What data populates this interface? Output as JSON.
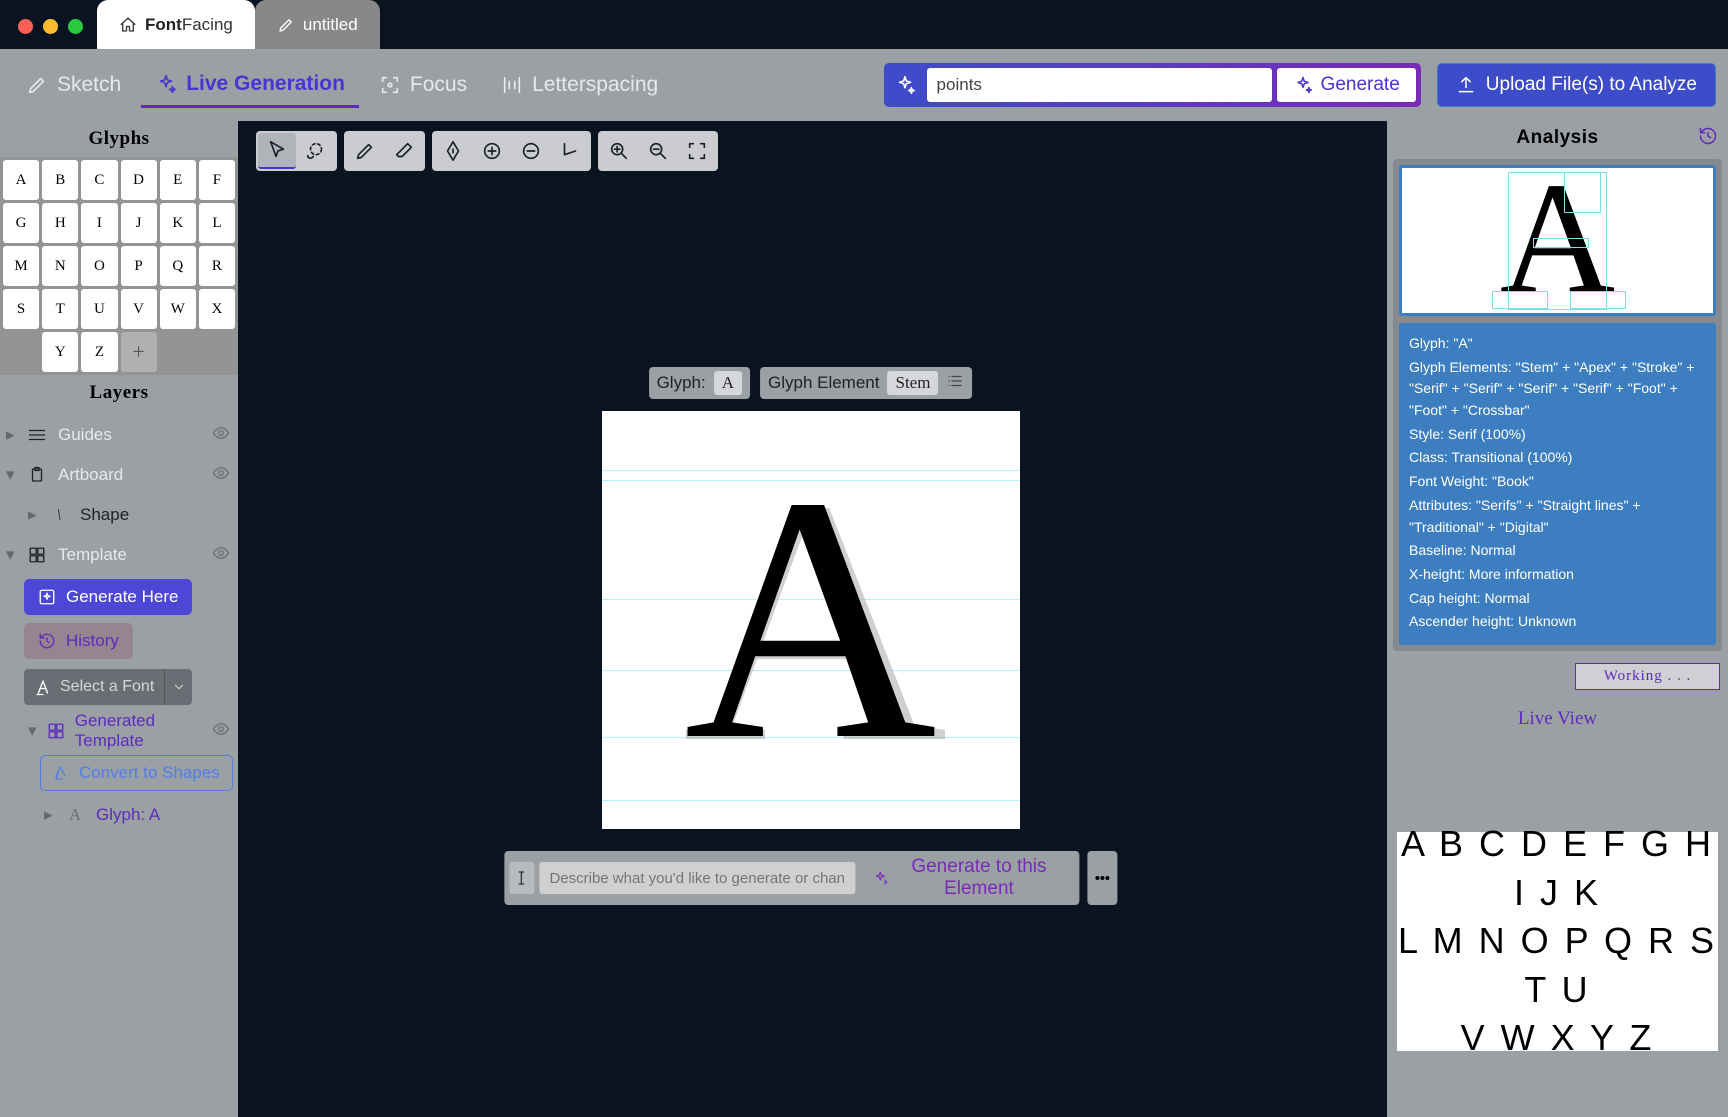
{
  "app_name_bold": "Font",
  "app_name_light": "Facing",
  "tabs": {
    "home": "FontFacing",
    "untitled": "untitled"
  },
  "modes": {
    "sketch": "Sketch",
    "live_gen": "Live Generation",
    "focus": "Focus",
    "letterspacing": "Letterspacing"
  },
  "generate": {
    "input_value": "points",
    "button": "Generate",
    "upload": "Upload File(s) to Analyze"
  },
  "glyphs_title": "Glyphs",
  "glyph_letters": [
    "A",
    "B",
    "C",
    "D",
    "E",
    "F",
    "G",
    "H",
    "I",
    "J",
    "K",
    "L",
    "M",
    "N",
    "O",
    "P",
    "Q",
    "R",
    "S",
    "T",
    "U",
    "V",
    "W",
    "X",
    "Y",
    "Z"
  ],
  "layers_title": "Layers",
  "layers": {
    "guides": "Guides",
    "artboard": "Artboard",
    "shape": "Shape",
    "template": "Template",
    "generate_here": "Generate Here",
    "history": "History",
    "select_font": "Select a Font",
    "generated_template": "Generated Template",
    "convert": "Convert to Shapes",
    "glyph_a": "Glyph: A"
  },
  "canvas": {
    "glyph_chip_label": "Glyph:",
    "glyph_chip_value": "A",
    "element_chip_label": "Glyph Element",
    "element_chip_value": "Stem",
    "prompt_placeholder": "Describe what you'd like to generate or change about this letterform",
    "prompt_button": "Generate to this Element"
  },
  "analysis": {
    "title": "Analysis",
    "glyph": "Glyph: \"A\"",
    "elements": "Glyph Elements: \"Stem\" + \"Apex\" + \"Stroke\" + \"Serif\" + \"Serif\" + \"Serif\" + \"Serif\" + \"Foot\" + \"Foot\" + \"Crossbar\"",
    "style": "Style: Serif (100%)",
    "class": "Class: Transitional (100%)",
    "weight": "Font Weight: \"Book\"",
    "attributes": "Attributes: \"Serifs\" + \"Straight lines\" + \"Traditional\" + \"Digital\"",
    "baseline": "Baseline: Normal",
    "xheight": "X-height: More information",
    "capheight": "Cap height: Normal",
    "ascender": "Ascender height: Unknown",
    "working": "Working . . ."
  },
  "live_view": {
    "title": "Live View",
    "line1": "A B C D E F G H I J K",
    "line2": "L M N O P Q R S T U",
    "line3": "V W X Y Z"
  }
}
